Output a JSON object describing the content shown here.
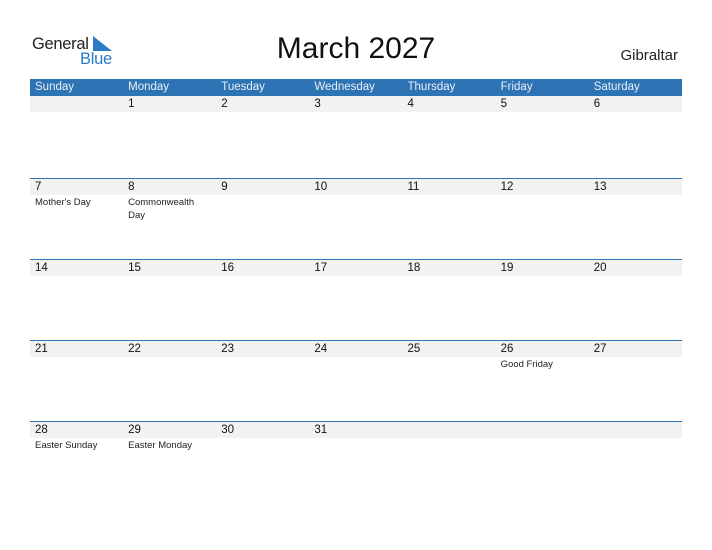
{
  "logo": {
    "part1": "General",
    "part2": "Blue"
  },
  "title": "March 2027",
  "country": "Gibraltar",
  "colors": {
    "header_bg": "#2e73b3",
    "date_band": "#f2f2f2",
    "brand_blue": "#2a7bc4"
  },
  "weekdays": [
    "Sunday",
    "Monday",
    "Tuesday",
    "Wednesday",
    "Thursday",
    "Friday",
    "Saturday"
  ],
  "weeks": [
    {
      "days": [
        "",
        "1",
        "2",
        "3",
        "4",
        "5",
        "6"
      ],
      "events": [
        "",
        "",
        "",
        "",
        "",
        "",
        ""
      ]
    },
    {
      "days": [
        "7",
        "8",
        "9",
        "10",
        "11",
        "12",
        "13"
      ],
      "events": [
        "Mother's Day",
        "Commonwealth Day",
        "",
        "",
        "",
        "",
        ""
      ]
    },
    {
      "days": [
        "14",
        "15",
        "16",
        "17",
        "18",
        "19",
        "20"
      ],
      "events": [
        "",
        "",
        "",
        "",
        "",
        "",
        ""
      ]
    },
    {
      "days": [
        "21",
        "22",
        "23",
        "24",
        "25",
        "26",
        "27"
      ],
      "events": [
        "",
        "",
        "",
        "",
        "",
        "Good Friday",
        ""
      ]
    },
    {
      "days": [
        "28",
        "29",
        "30",
        "31",
        "",
        "",
        ""
      ],
      "events": [
        "Easter Sunday",
        "Easter Monday",
        "",
        "",
        "",
        "",
        ""
      ]
    }
  ]
}
